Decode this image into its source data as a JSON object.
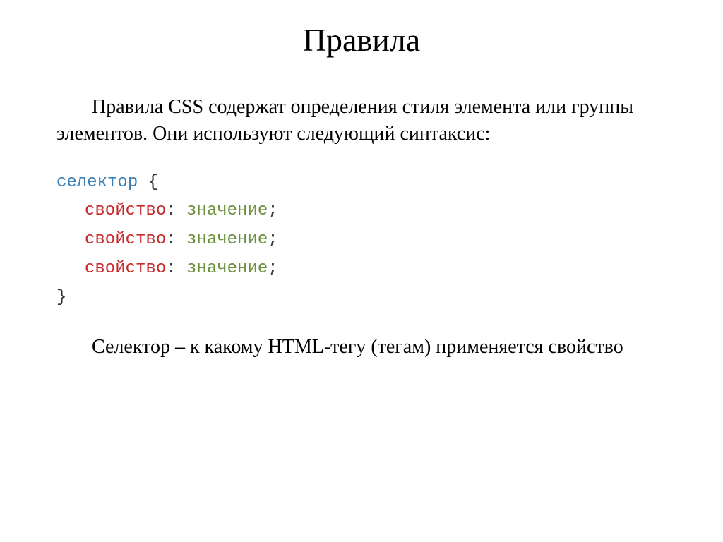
{
  "title": "Правила",
  "paragraph1": "Правила CSS содержат определения стиля элемента или группы элементов. Они используют следующий синтаксис:",
  "code": {
    "selector": "селектор",
    "openBrace": "{",
    "lines": [
      {
        "property": "свойство",
        "colon": ":",
        "value": "значение",
        "semicolon": ";"
      },
      {
        "property": "свойство",
        "colon": ":",
        "value": "значение",
        "semicolon": ";"
      },
      {
        "property": "свойство",
        "colon": ":",
        "value": "значение",
        "semicolon": ";"
      }
    ],
    "closeBrace": "}"
  },
  "paragraph2": "Селектор – к какому HTML-тегу (тегам) применяется свойство"
}
